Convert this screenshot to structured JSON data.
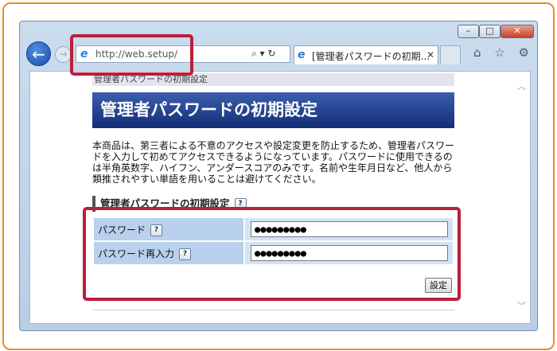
{
  "browser": {
    "window_controls": {
      "minimize": "–",
      "maximize": "□",
      "close": "✕"
    },
    "back_icon": "arrow-left-icon",
    "forward_icon": "arrow-right-icon",
    "address": {
      "url": "http://web.setup/",
      "search_symbol": "⌕ ▾",
      "refresh_symbol": "↻"
    },
    "tab": {
      "label": "[管理者パスワードの初期...",
      "close": "✕"
    },
    "tool_icons": "⌂ ☆ ⚙"
  },
  "page": {
    "breadcrumb": "管理者パスワードの初期設定",
    "title": "管理者パスワードの初期設定",
    "description": "本商品は、第三者による不意のアクセスや設定変更を防止するため、管理者パスワードを入力して初めてアクセスできるようになっています。パスワードに使用できるのは半角英数字、ハイフン、アンダースコアのみです。名前や生年月日など、他人から類推されやすい単語を用いることは避けてください。",
    "section_heading": "管理者パスワードの初期設定",
    "help_symbol": "?",
    "form": {
      "password_label": "パスワード",
      "password_value": "●●●●●●●●●",
      "confirm_label": "パスワード再入力",
      "confirm_value": "●●●●●●●●●",
      "submit_label": "設定"
    }
  },
  "colors": {
    "frame_border": "#f08a1e",
    "highlight": "#b8203a",
    "title_bg": "#1f3a8a",
    "label_cell": "#b9d1ec",
    "input_cell": "#d3e3f4"
  }
}
